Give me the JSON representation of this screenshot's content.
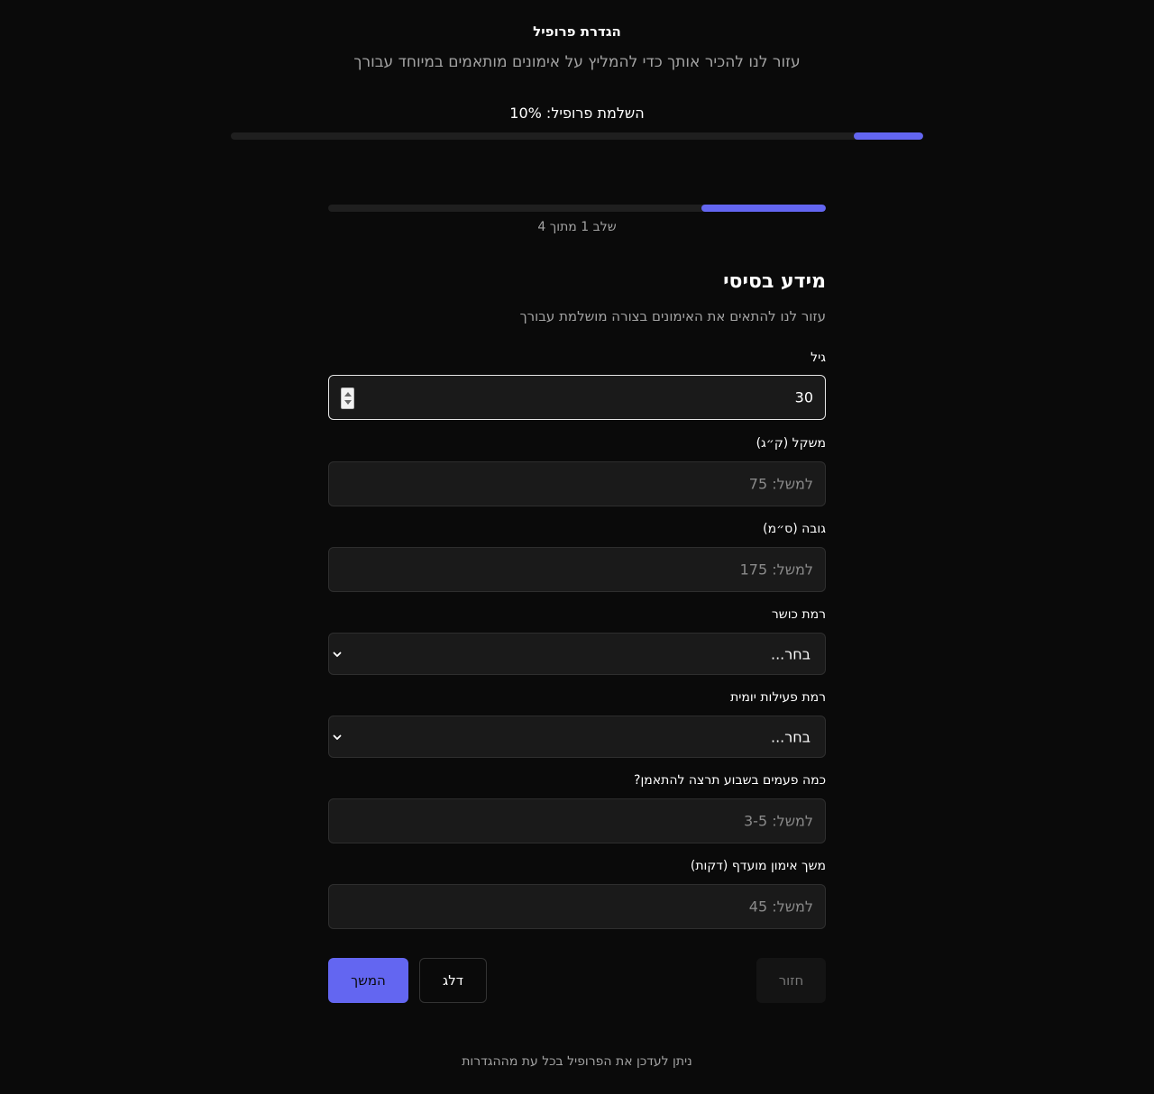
{
  "header": {
    "title": "הגדרת פרופיל",
    "subtitle": "עזור לנו להכיר אותך כדי להמליץ על אימונים מותאמים במיוחד עבורך"
  },
  "overall_progress": {
    "label": "השלמת פרופיל: 10%",
    "percent": 10
  },
  "step_progress": {
    "text": "שלב 1 מתוך 4",
    "current": 1,
    "total": 4
  },
  "section": {
    "title": "מידע בסיסי",
    "description": "עזור לנו להתאים את האימונים בצורה מושלמת עבורך"
  },
  "fields": {
    "age": {
      "label": "גיל",
      "value": "30"
    },
    "weight": {
      "label": "משקל (ק״ג)",
      "placeholder": "למשל: 75"
    },
    "height": {
      "label": "גובה (ס״מ)",
      "placeholder": "למשל: 175"
    },
    "fitness_level": {
      "label": "רמת כושר",
      "value": "בחר..."
    },
    "daily_activity": {
      "label": "רמת פעילות יומית",
      "value": "בחר..."
    },
    "weekly_frequency": {
      "label": "כמה פעמים בשבוע תרצה להתאמן?",
      "placeholder": "למשל: 3-5"
    },
    "workout_duration": {
      "label": "משך אימון מועדף (דקות)",
      "placeholder": "למשל: 45"
    }
  },
  "buttons": {
    "continue": "המשך",
    "skip": "דלג",
    "back": "חזור"
  },
  "footer": {
    "note": "ניתן לעדכן את הפרופיל בכל עת מההגדרות"
  },
  "colors": {
    "accent": "#6366f1",
    "background": "#0a0a0a",
    "input_bg": "#1a1a1a"
  },
  "icons": {
    "select_arrow": "chevron-down-icon",
    "number_spinner": "spinner-icon"
  }
}
